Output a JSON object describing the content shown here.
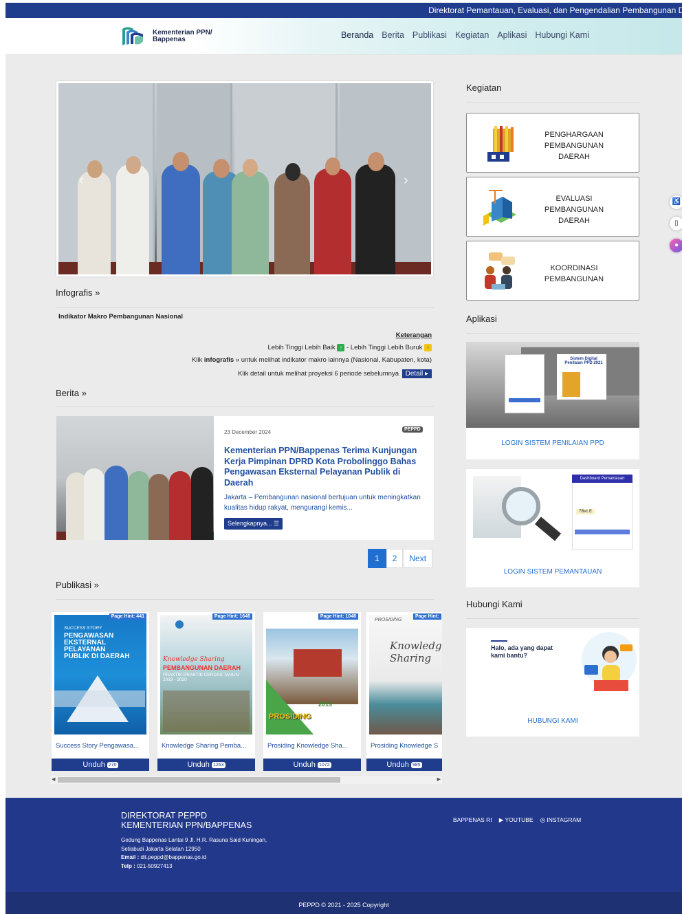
{
  "topbar": {
    "ticker": "Direktorat Pemantauan, Evaluasi, dan Pengendalian Pembangunan Da"
  },
  "header": {
    "brand_line1": "Kementerian PPN/",
    "brand_line2": "Bappenas",
    "nav": [
      "Beranda",
      "Berita",
      "Publikasi",
      "Kegiatan",
      "Aplikasi",
      "Hubungi Kami"
    ]
  },
  "slider": {
    "prev": "‹",
    "next": "›"
  },
  "infografis": {
    "title": "Infografis »",
    "indicator_title": "Indikator Makro Pembangunan Nasional",
    "keterangan": "Keterangan",
    "legend_text1": "Lebih Tinggi Lebih Baik",
    "legend_sep": " - ",
    "legend_text2": "Lebih Tinggi Lebih Buruk",
    "click_prefix": "Klik ",
    "click_bold": "infografis",
    "click_suffix": " » untuk melihat indikator makro lainnya (Nasional, Kabupaten, kota)",
    "detail_text": "Klik detail untuk melihat proyeksi 6 periode sebelumnya",
    "detail_btn": "Detail ▸"
  },
  "berita": {
    "title": "Berita »",
    "date": "23 December 2024",
    "badge": "PEPPD",
    "headline": "Kementerian PPN/Bappenas Terima Kunjungan Kerja Pimpinan DPRD Kota Probolinggo Bahas Pengawasan Eksternal Pelayanan Publik di Daerah",
    "excerpt": "Jakarta – Pembangunan nasional bertujuan untuk meningkatkan kualitas hidup rakyat, mengurangi kemis...",
    "read_more": "Selengkapnya... ☰"
  },
  "pagination": {
    "p1": "1",
    "p2": "2",
    "next": "Next"
  },
  "publikasi": {
    "title": "Publikasi »",
    "items": [
      {
        "hint": "Page Hint: 441",
        "name": "Success Story Pengawasa...",
        "unduh": "Unduh",
        "count": "270",
        "cover_t1": "SUCCESS STORY",
        "cover_t2": "PENGAWASAN EKSTERNAL PELAYANAN PUBLIK DI DAERAH"
      },
      {
        "hint": "Page Hint: 1646",
        "name": "Knowledge Sharing Pemba...",
        "unduh": "Unduh",
        "count": "1263",
        "cover_t1": "Knowledge Sharing",
        "cover_t2": "PEMBANGUNAN DAERAH",
        "cover_t3": "PRAKTIK-PRAKTIK CERDAS TAHUN 2019 - 2020"
      },
      {
        "hint": "Page Hint: 1048",
        "name": "Prosiding Knowledge Sha...",
        "unduh": "Unduh",
        "count": "1072",
        "cover_t1": "PROSIDING",
        "cover_t2": "2019"
      },
      {
        "hint": "Page Hint:",
        "name": "Prosiding Knowledge S",
        "unduh": "Unduh",
        "count": "985",
        "cover_t1": "PROSIDING",
        "cover_t2": "Knowledge Sharing"
      }
    ]
  },
  "kegiatan": {
    "title": "Kegiatan",
    "items": [
      "PENGHARGAAN PEMBANGUNAN DAERAH",
      "EVALUASI PEMBANGUNAN DAERAH",
      "KOORDINASI PEMBANGUNAN"
    ]
  },
  "aplikasi": {
    "title": "Aplikasi",
    "app1": "LOGIN SISTEM PENILAIAN PPD",
    "app1_img_text": "Sistem Digital Penilaian PPD 2021",
    "app2": "LOGIN SISTEM PEMANTAUAN",
    "app2_img_text": "Dashboard Pemantauan",
    "app2_captcha": "7Bvc E"
  },
  "hubungi": {
    "title": "Hubungi Kami",
    "card_text": "Halo, ada yang dapat kami bantu?",
    "link": "HUBUNGI KAMI"
  },
  "footer": {
    "line1": "DIREKTORAT PEPPD",
    "line2": "KEMENTERIAN PPN/BAPPENAS",
    "addr1": "Gedung Bappenas Lantai 9 Jl. H.R. Rasuna Said Kuningan,",
    "addr2": "Setiabudi Jakarta Selatan 12950",
    "email_label": "Email :",
    "email": " dit.peppd@bappenas.go.id",
    "telp_label": "Telp :",
    "telp": " 021-50927413",
    "social": [
      "BAPPENAS RI",
      "YOUTUBE",
      "INSTAGRAM"
    ],
    "copyright": "PEPPD © 2021 - 2025 Copyright"
  },
  "colors": {
    "brand": "#1f3c8d",
    "link": "#1f6fd1",
    "bg": "#ebebeb"
  }
}
